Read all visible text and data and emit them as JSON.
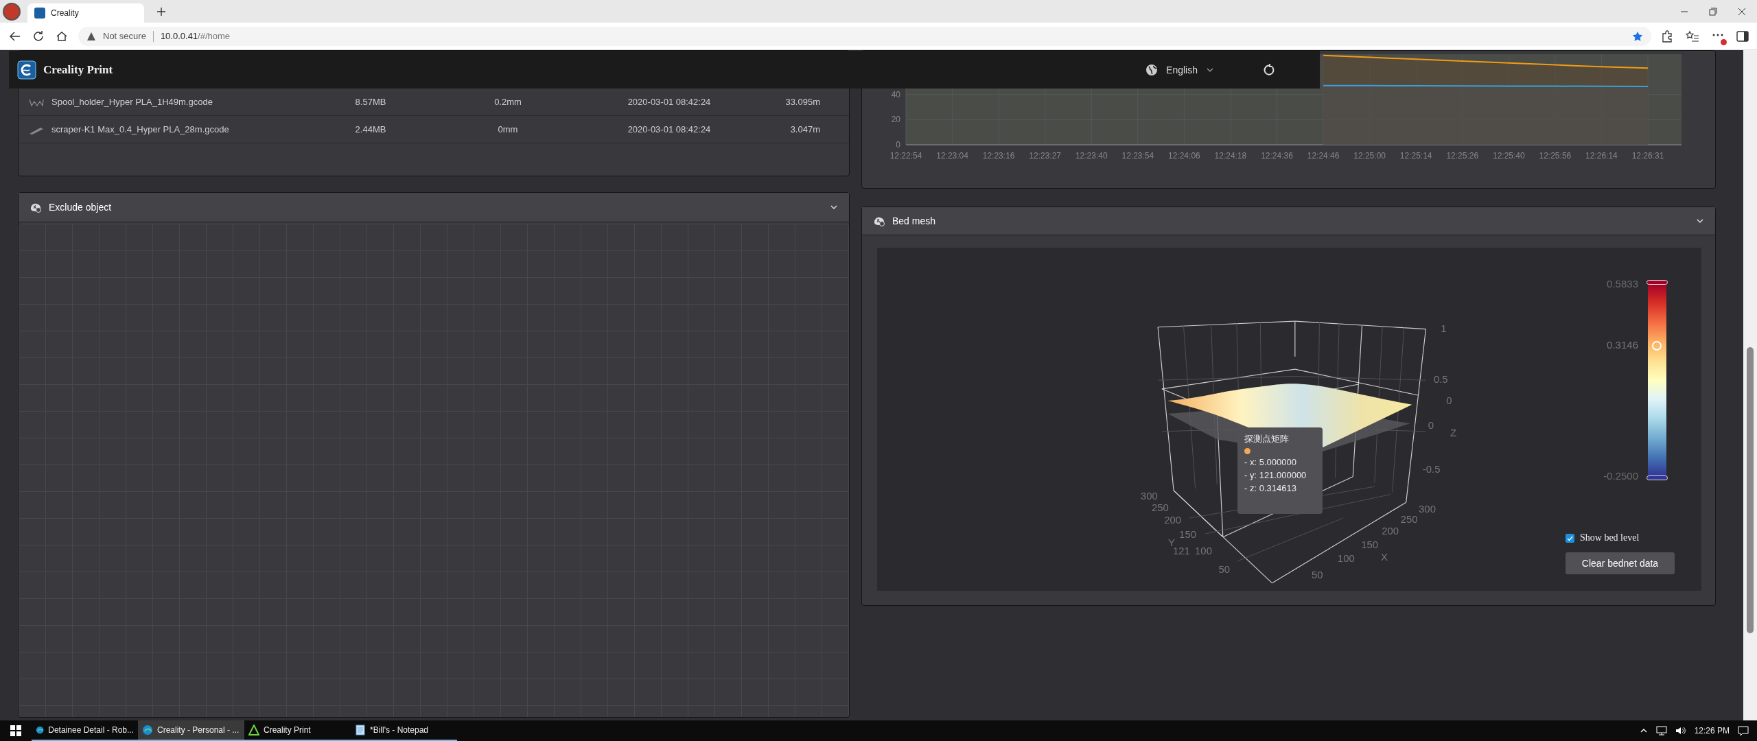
{
  "browser": {
    "tab_title": "Creality",
    "security": "Not secure",
    "host": "10.0.0.41",
    "path": "/#/home"
  },
  "app_header": {
    "title": "Creality Print",
    "language": "English"
  },
  "files": {
    "rows": [
      {
        "kind": "spool",
        "cells": [
          "Spool_holder_Hyper PLA_1H49m.gcode",
          "8.57MB",
          "0.2mm",
          "2020-03-01 08:42:24",
          "33.095m"
        ]
      },
      {
        "kind": "scraper",
        "cells": [
          "scraper-K1 Max_0.4_Hyper PLA_28m.gcode",
          "2.44MB",
          "0mm",
          "2020-03-01 08:42:24",
          "3.047m"
        ]
      }
    ]
  },
  "temperature_chart": {
    "chart_data": {
      "type": "area",
      "categories": [
        "12:22:54",
        "12:23:04",
        "12:23:16",
        "12:23:27",
        "12:23:40",
        "12:23:54",
        "12:24:06",
        "12:24:18",
        "12:24:36",
        "12:24:46",
        "12:25:00",
        "12:25:14",
        "12:25:26",
        "12:25:40",
        "12:25:56",
        "12:26:14",
        "12:26:31"
      ],
      "ylim": [
        0,
        72
      ],
      "yticks": [
        0,
        20,
        40
      ],
      "grid": true,
      "series": [
        {
          "color": "#f39c12",
          "values": [
            null,
            null,
            null,
            null,
            null,
            null,
            null,
            null,
            null,
            71,
            69.5,
            68,
            66.5,
            65,
            63.5,
            62,
            61
          ]
        },
        {
          "color": "#3aa0d8",
          "values": [
            null,
            null,
            null,
            null,
            null,
            null,
            null,
            null,
            null,
            47,
            47,
            46.9,
            46.8,
            46.7,
            46.6,
            46.5,
            46.4
          ]
        }
      ]
    }
  },
  "exclude_object": {
    "title": "Exclude object"
  },
  "bed_mesh": {
    "title": "Bed mesh",
    "plot": {
      "z_ticks": [
        "1",
        "0.5",
        "0",
        "0",
        "-0.5"
      ],
      "z_title": "Z",
      "x_ticks": [
        "300",
        "250",
        "200",
        "150",
        "100",
        "50"
      ],
      "x_title": "X",
      "y_ticks": [
        "300",
        "250",
        "200",
        "150",
        "100",
        "50"
      ],
      "y_title": "Y",
      "y_pointer": "121"
    },
    "tooltip": {
      "title": "探测点矩阵",
      "color": "#f5a85a",
      "lines": [
        "- x: 5.000000",
        "- y: 121.000000",
        "- z: 0.314613"
      ]
    },
    "legend": {
      "max": "0.5833",
      "min": "-0.2500",
      "value": "0.3146",
      "level": 0.678
    },
    "show_bed_level": {
      "label": "Show bed level",
      "checked": true
    },
    "clear_button": "Clear bednet data"
  },
  "taskbar": {
    "items": [
      {
        "kind": "browser",
        "label": "Detainee Detail - Rob...",
        "selected": false
      },
      {
        "kind": "browser",
        "label": "Creality - Personal - ...",
        "selected": true
      },
      {
        "kind": "slicer",
        "label": "Creality Print",
        "selected": false
      },
      {
        "kind": "notepad",
        "label": "*Bill's - Notepad",
        "selected": false
      }
    ],
    "clock": "12:26 PM"
  }
}
